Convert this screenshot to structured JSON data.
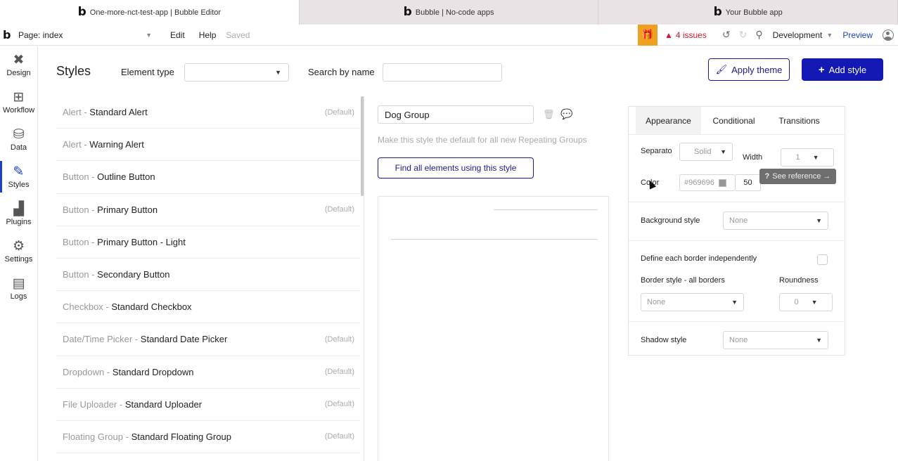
{
  "browser_tabs": [
    {
      "title": "One-more-nct-test-app | Bubble Editor",
      "active": true
    },
    {
      "title": "Bubble | No-code apps",
      "active": false
    },
    {
      "title": "Your Bubble app",
      "active": false
    }
  ],
  "topbar": {
    "logo": "b",
    "page_label": "Page: index",
    "menu_edit": "Edit",
    "menu_help": "Help",
    "saved": "Saved",
    "issues": "4 issues",
    "environment": "Development",
    "preview": "Preview"
  },
  "leftnav": [
    {
      "label": "Design",
      "icon": "design-icon",
      "glyph": "✖",
      "active": false
    },
    {
      "label": "Workflow",
      "icon": "workflow-icon",
      "glyph": "⊞",
      "active": false
    },
    {
      "label": "Data",
      "icon": "database-icon",
      "glyph": "⛁",
      "active": false
    },
    {
      "label": "Styles",
      "icon": "brush-icon",
      "glyph": "✎",
      "active": true
    },
    {
      "label": "Plugins",
      "icon": "plugins-icon",
      "glyph": "▟",
      "active": false
    },
    {
      "label": "Settings",
      "icon": "gear-icon",
      "glyph": "⚙",
      "active": false
    },
    {
      "label": "Logs",
      "icon": "logs-icon",
      "glyph": "▤",
      "active": false
    }
  ],
  "header": {
    "title": "Styles",
    "element_type_label": "Element type",
    "element_type_value": "",
    "search_label": "Search by name",
    "search_value": "",
    "apply_theme": "Apply theme",
    "add_style": "Add style"
  },
  "styles": [
    {
      "type": "Alert -",
      "name": "Standard Alert",
      "default": "(Default)"
    },
    {
      "type": "Alert -",
      "name": "Warning Alert",
      "default": ""
    },
    {
      "type": "Button -",
      "name": "Outline Button",
      "default": ""
    },
    {
      "type": "Button -",
      "name": "Primary Button",
      "default": "(Default)"
    },
    {
      "type": "Button -",
      "name": "Primary Button - Light",
      "default": ""
    },
    {
      "type": "Button -",
      "name": "Secondary Button",
      "default": ""
    },
    {
      "type": "Checkbox -",
      "name": "Standard Checkbox",
      "default": ""
    },
    {
      "type": "Date/Time Picker -",
      "name": "Standard Date Picker",
      "default": "(Default)"
    },
    {
      "type": "Dropdown -",
      "name": "Standard Dropdown",
      "default": "(Default)"
    },
    {
      "type": "File Uploader -",
      "name": "Standard Uploader",
      "default": "(Default)"
    },
    {
      "type": "Floating Group -",
      "name": "Standard Floating Group",
      "default": "(Default)"
    }
  ],
  "editor": {
    "style_name": "Dog Group",
    "default_hint": "Make this style the default for all new Repeating Groups",
    "find_button": "Find all elements using this style"
  },
  "panel": {
    "tabs": [
      "Appearance",
      "Conditional",
      "Transitions"
    ],
    "separator_label": "Separato",
    "separator_value": "Solid",
    "width_label": "Width",
    "width_value": "1",
    "color_label": "Color",
    "color_value": "#969696",
    "opacity_value": "50",
    "tooltip": "See reference →",
    "background_label": "Background style",
    "background_value": "None",
    "define_border_label": "Define each border independently",
    "border_style_label": "Border style - all borders",
    "border_style_value": "None",
    "roundness_label": "Roundness",
    "roundness_value": "0",
    "shadow_label": "Shadow style",
    "shadow_value": "None"
  },
  "colors": {
    "accent": "#1418b4",
    "issues": "#d0192e",
    "gift": "#f0a020",
    "separator_color": "#969696"
  }
}
